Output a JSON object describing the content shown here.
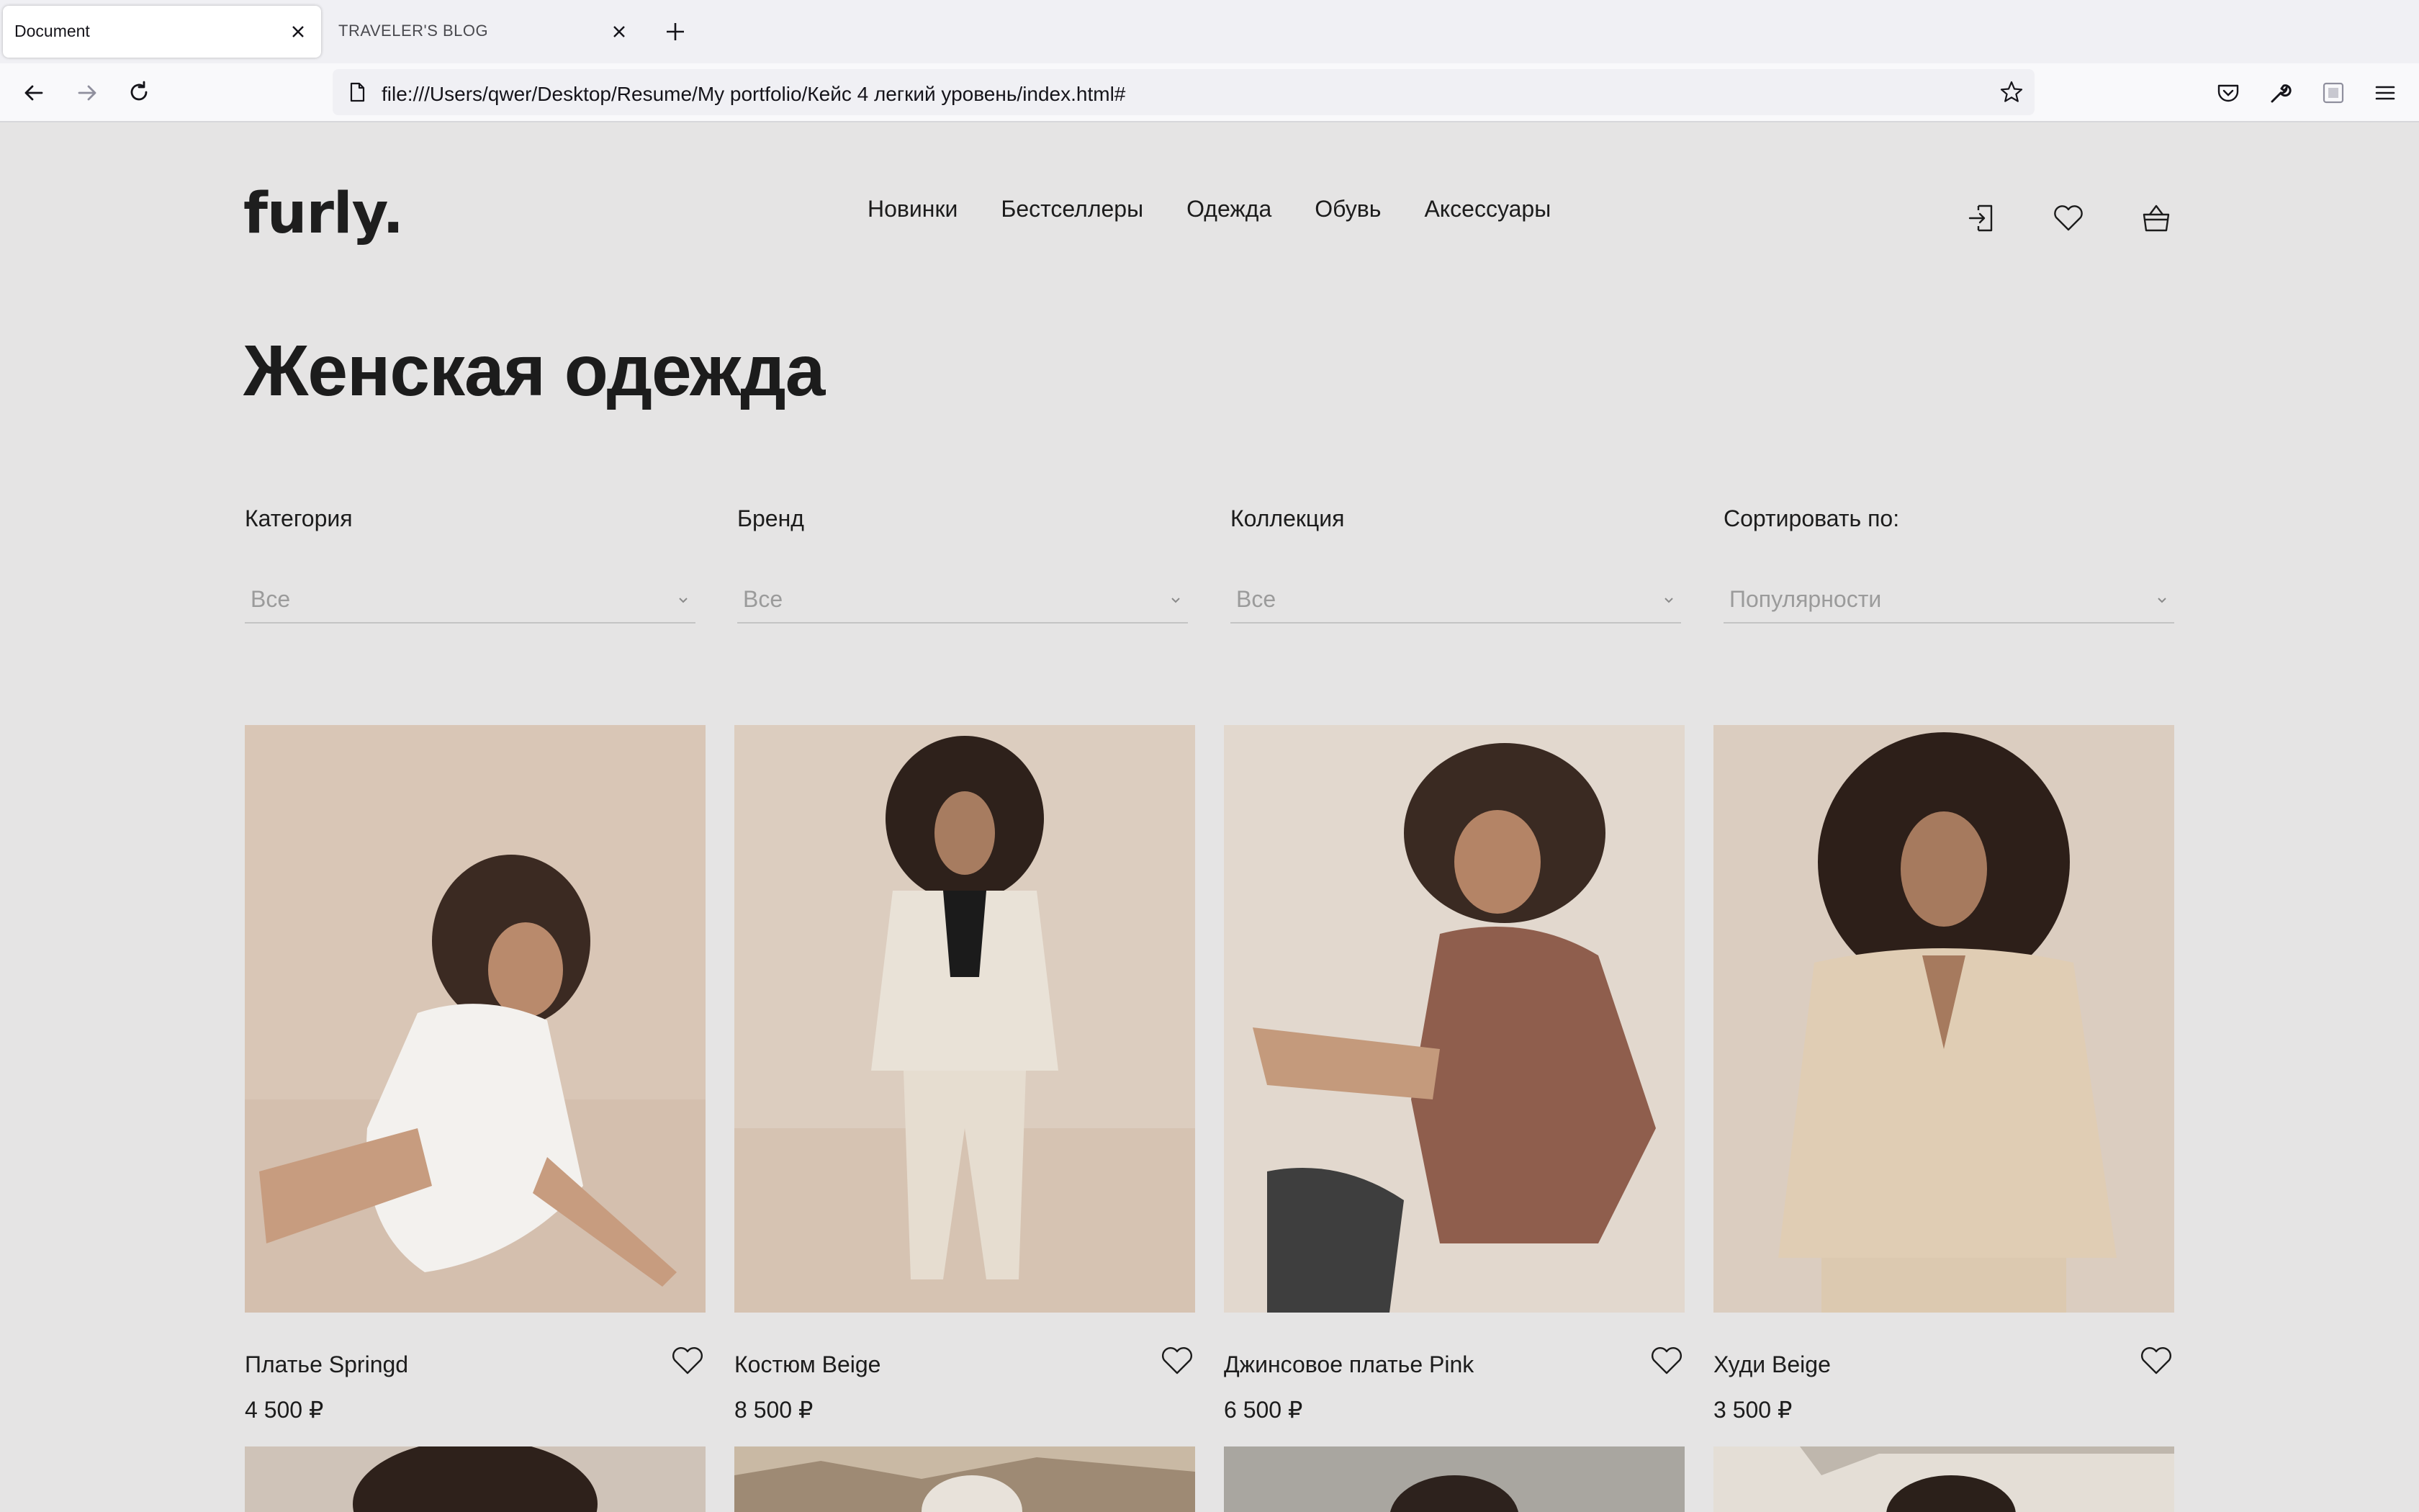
{
  "browser": {
    "tabs": [
      {
        "title": "Document",
        "active": true
      },
      {
        "title": "TRAVELER'S BLOG",
        "active": false
      }
    ],
    "url": "file:///Users/qwer/Desktop/Resume/My portfolio/Кейс 4 легкий уровень/index.html#"
  },
  "site": {
    "logo": "furly.",
    "nav": [
      "Новинки",
      "Бестселлеры",
      "Одежда",
      "Обувь",
      "Аксессуары"
    ],
    "header_icons": [
      "login-icon",
      "heart-icon",
      "basket-icon"
    ]
  },
  "page": {
    "title": "Женская одежда",
    "filters": [
      {
        "label": "Категория",
        "value": "Все"
      },
      {
        "label": "Бренд",
        "value": "Все"
      },
      {
        "label": "Коллекция",
        "value": "Все"
      },
      {
        "label": "Сортировать по:",
        "value": "Популярности"
      }
    ],
    "products": [
      {
        "name": "Платье Springd",
        "price": "4 500 ₽"
      },
      {
        "name": "Костюм Beige",
        "price": "8 500 ₽"
      },
      {
        "name": "Джинсовое платье Pink",
        "price": "6 500 ₽"
      },
      {
        "name": "Худи Beige",
        "price": "3 500 ₽"
      }
    ]
  },
  "colors": {
    "page_bg": "#e5e4e4",
    "text": "#1c1c1c",
    "muted": "#9b9b9b"
  }
}
